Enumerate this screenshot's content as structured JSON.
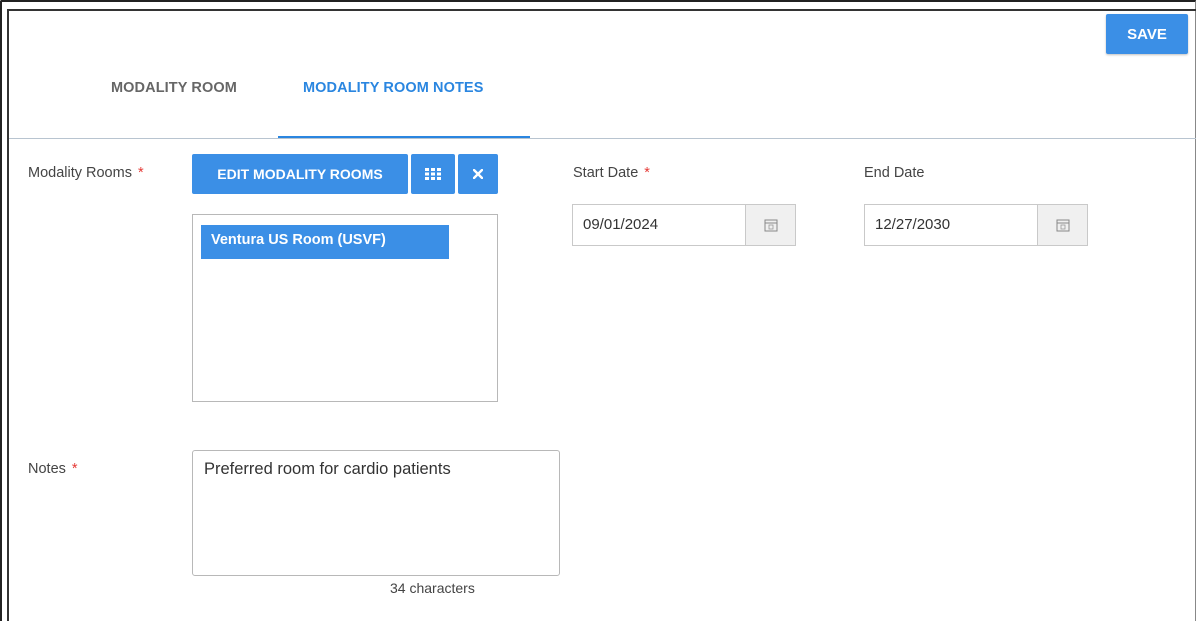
{
  "toolbar": {
    "save_label": "SAVE"
  },
  "tabs": [
    {
      "label": "MODALITY ROOM",
      "active": false
    },
    {
      "label": "MODALITY ROOM NOTES",
      "active": true
    }
  ],
  "form": {
    "modality_rooms": {
      "label": "Modality Rooms",
      "required_mark": "*",
      "edit_button_label": "EDIT MODALITY ROOMS",
      "grid_icon": "grid-icon",
      "clear_icon": "close-icon",
      "selected_items": [
        "Ventura US Room (USVF)"
      ]
    },
    "start_date": {
      "label": "Start Date",
      "required_mark": "*",
      "value": "09/01/2024",
      "icon": "calendar-icon"
    },
    "end_date": {
      "label": "End Date",
      "value": "12/27/2030",
      "icon": "calendar-icon"
    },
    "notes": {
      "label": "Notes",
      "required_mark": "*",
      "value": "Preferred room for cardio patients",
      "char_count": "34 characters"
    }
  },
  "colors": {
    "accent": "#3b8fe6",
    "tab_active": "#2a86e0",
    "required": "#e53935"
  }
}
